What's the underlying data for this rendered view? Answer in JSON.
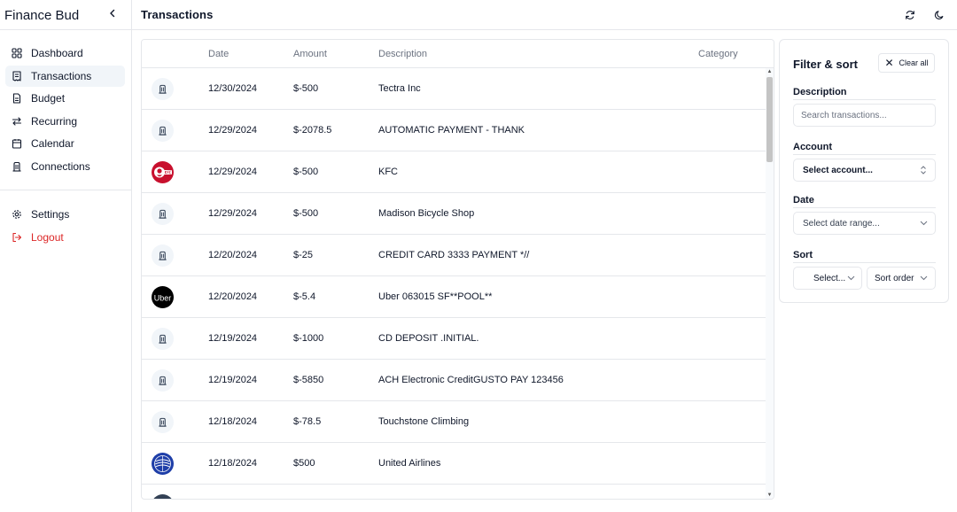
{
  "app": {
    "brand": "Finance Bud"
  },
  "sidebar": {
    "items": [
      {
        "label": "Dashboard",
        "icon": "dashboard-icon",
        "active": false
      },
      {
        "label": "Transactions",
        "icon": "receipt-icon",
        "active": true
      },
      {
        "label": "Budget",
        "icon": "document-icon",
        "active": false
      },
      {
        "label": "Recurring",
        "icon": "repeat-icon",
        "active": false
      },
      {
        "label": "Calendar",
        "icon": "calendar-icon",
        "active": false
      },
      {
        "label": "Connections",
        "icon": "bank-icon",
        "active": false
      }
    ],
    "settings_label": "Settings",
    "logout_label": "Logout"
  },
  "header": {
    "title": "Transactions"
  },
  "table": {
    "columns": {
      "date": "Date",
      "amount": "Amount",
      "description": "Description",
      "category": "Category"
    },
    "rows": [
      {
        "logo": "bank",
        "date": "12/30/2024",
        "amount": "$-500",
        "description": "Tectra Inc",
        "category": ""
      },
      {
        "logo": "bank",
        "date": "12/29/2024",
        "amount": "$-2078.5",
        "description": "AUTOMATIC PAYMENT - THANK",
        "category": ""
      },
      {
        "logo": "kfc",
        "date": "12/29/2024",
        "amount": "$-500",
        "description": "KFC",
        "category": ""
      },
      {
        "logo": "bank",
        "date": "12/29/2024",
        "amount": "$-500",
        "description": "Madison Bicycle Shop",
        "category": ""
      },
      {
        "logo": "bank",
        "date": "12/20/2024",
        "amount": "$-25",
        "description": "CREDIT CARD 3333 PAYMENT *//",
        "category": ""
      },
      {
        "logo": "uber",
        "date": "12/20/2024",
        "amount": "$-5.4",
        "description": "Uber 063015 SF**POOL**",
        "category": ""
      },
      {
        "logo": "bank",
        "date": "12/19/2024",
        "amount": "$-1000",
        "description": "CD DEPOSIT .INITIAL.",
        "category": ""
      },
      {
        "logo": "bank",
        "date": "12/19/2024",
        "amount": "$-5850",
        "description": "ACH Electronic CreditGUSTO PAY 123456",
        "category": ""
      },
      {
        "logo": "bank",
        "date": "12/18/2024",
        "amount": "$-78.5",
        "description": "Touchstone Climbing",
        "category": ""
      },
      {
        "logo": "united",
        "date": "12/18/2024",
        "amount": "$500",
        "description": "United Airlines",
        "category": ""
      },
      {
        "logo": "dark",
        "date": "",
        "amount": "",
        "description": "",
        "category": ""
      }
    ]
  },
  "filter": {
    "title": "Filter & sort",
    "clear_label": "Clear all",
    "description_label": "Description",
    "search_placeholder": "Search transactions...",
    "account_label": "Account",
    "account_value": "Select account...",
    "date_label": "Date",
    "date_value": "Select date range...",
    "sort_label": "Sort",
    "sort_field_value": "Select...",
    "sort_order_value": "Sort order"
  },
  "colors": {
    "accent_active_bg": "#f1f5f9",
    "logout": "#dc2626",
    "border": "#e5e7eb",
    "muted_text": "#6b7280"
  }
}
